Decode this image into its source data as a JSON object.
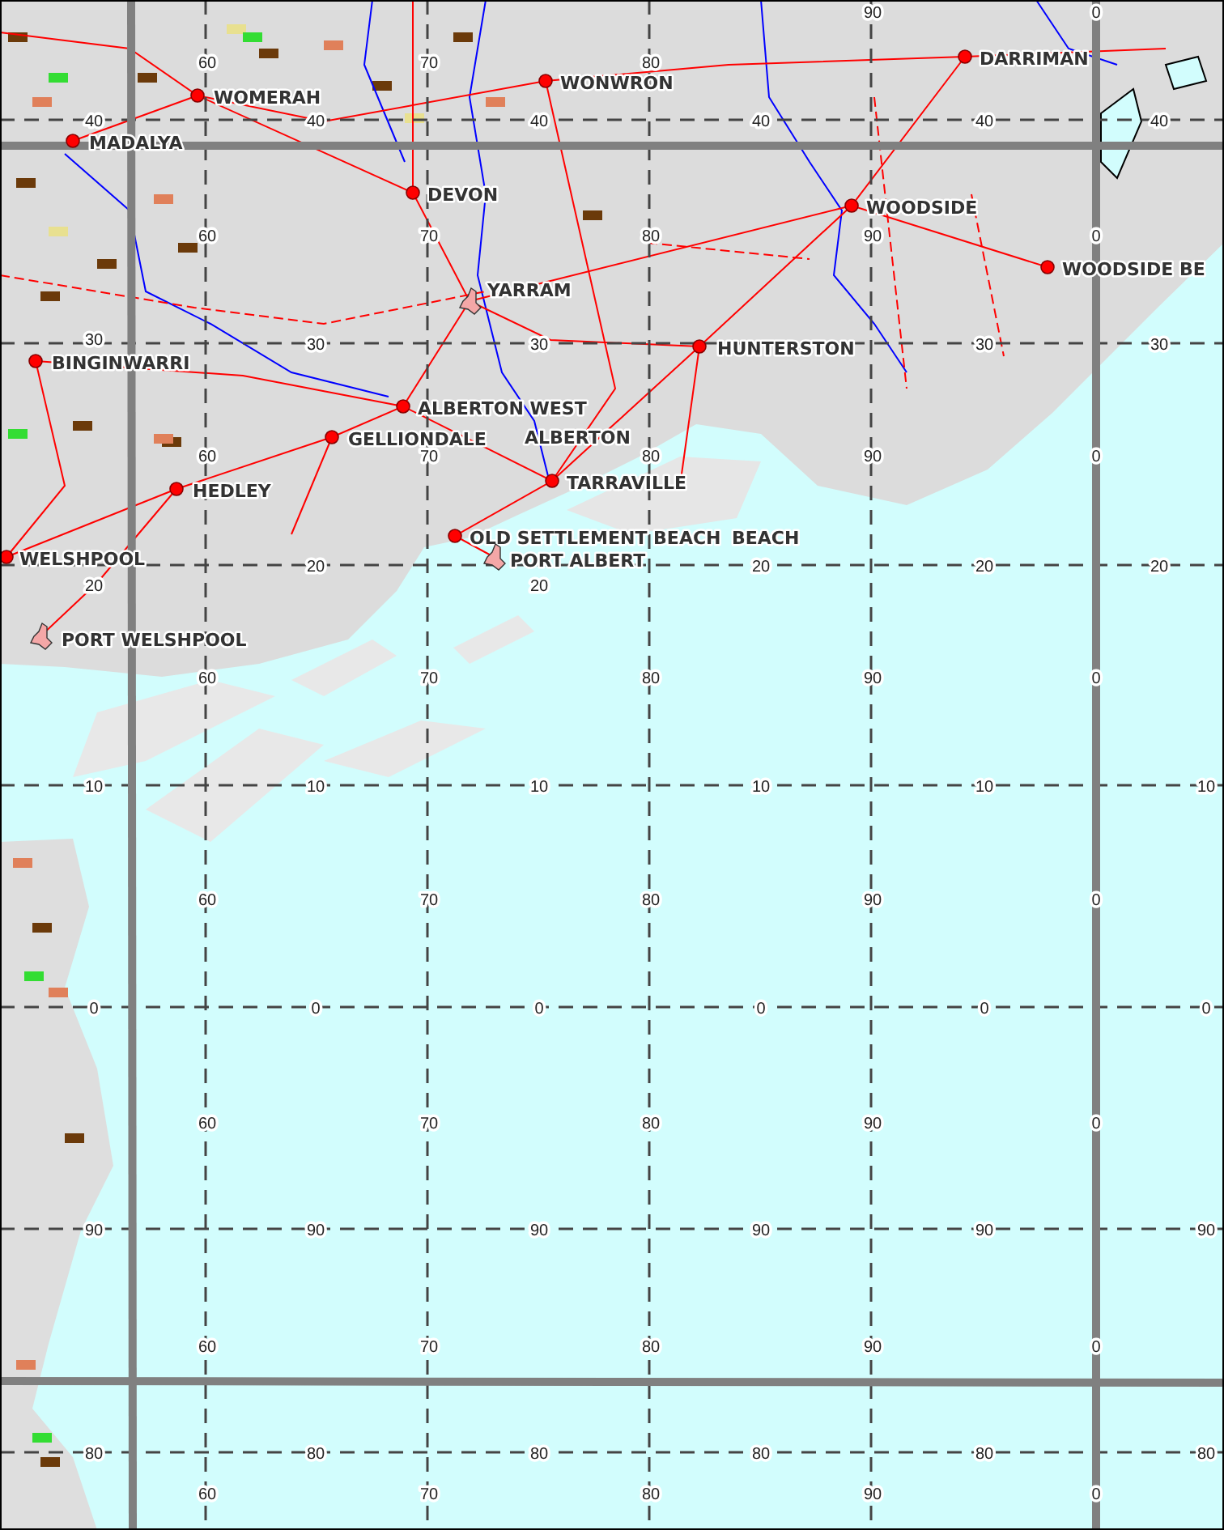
{
  "map": {
    "places": [
      {
        "name": "WONWRON",
        "kind": "locality"
      },
      {
        "name": "DARRIMAN",
        "kind": "locality"
      },
      {
        "name": "WOMERAH",
        "kind": "locality"
      },
      {
        "name": "MADALYA",
        "kind": "locality"
      },
      {
        "name": "DEVON",
        "kind": "locality"
      },
      {
        "name": "WOODSIDE",
        "kind": "locality"
      },
      {
        "name": "WOODSIDE BE",
        "kind": "locality"
      },
      {
        "name": "YARRAM",
        "kind": "urban"
      },
      {
        "name": "BINGINWARRI",
        "kind": "locality"
      },
      {
        "name": "HUNTERSTON",
        "kind": "locality"
      },
      {
        "name": "ALBERTON WEST",
        "kind": "locality"
      },
      {
        "name": "ALBERTON",
        "kind": "label"
      },
      {
        "name": "GELLIONDALE",
        "kind": "locality"
      },
      {
        "name": "TARRAVILLE",
        "kind": "locality"
      },
      {
        "name": "HEDLEY",
        "kind": "locality"
      },
      {
        "name": "OLD SETTLEMENT BEACH",
        "kind": "locality"
      },
      {
        "name": "BEACH",
        "kind": "label"
      },
      {
        "name": "WELSHPOOL",
        "kind": "locality"
      },
      {
        "name": "PORT ALBERT",
        "kind": "urban"
      },
      {
        "name": "PORT WELSHPOOL",
        "kind": "urban"
      }
    ],
    "grid": {
      "northing_rows": [
        {
          "labels": [
            "40",
            "40",
            "40",
            "40",
            "40",
            "40"
          ]
        },
        {
          "labels": [
            "30",
            "30",
            "30",
            "30",
            "30"
          ]
        },
        {
          "labels": [
            "20",
            "20",
            "20",
            "20",
            "20",
            "20"
          ]
        },
        {
          "labels": [
            "10",
            "10",
            "10",
            "10",
            "10",
            "10"
          ]
        },
        {
          "labels": [
            "0",
            "0",
            "0",
            "0",
            "0",
            "0"
          ]
        },
        {
          "labels": [
            "90",
            "90",
            "90",
            "90",
            "90",
            "90"
          ]
        },
        {
          "labels": [
            "80",
            "80",
            "80",
            "80",
            "80",
            "80"
          ]
        }
      ],
      "easting_rows": [
        {
          "labels": [
            "60",
            "70",
            "80",
            "90",
            "0"
          ]
        },
        {
          "labels": [
            "60",
            "70",
            "80",
            "90",
            "0"
          ]
        },
        {
          "labels": [
            "60",
            "70",
            "80",
            "90",
            "0"
          ]
        },
        {
          "labels": [
            "60",
            "70",
            "80",
            "90",
            "0"
          ]
        },
        {
          "labels": [
            "60",
            "70",
            "80",
            "90",
            "0"
          ]
        },
        {
          "labels": [
            "60",
            "70",
            "80",
            "90",
            "0"
          ]
        },
        {
          "labels": [
            "60",
            "70",
            "80",
            "90",
            "0"
          ]
        },
        {
          "labels": [
            "60",
            "70",
            "80",
            "90",
            "0"
          ]
        }
      ]
    }
  }
}
